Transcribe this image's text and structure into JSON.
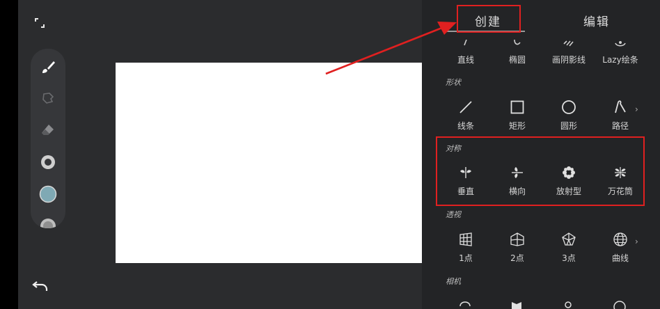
{
  "tabs": {
    "create": "创建",
    "edit": "编辑"
  },
  "sections": {
    "row0": {
      "items": [
        {
          "label": "直线",
          "icon": "straight-line-icon"
        },
        {
          "label": "椭圆",
          "icon": "ellipse-icon"
        },
        {
          "label": "画阴影线",
          "icon": "hatch-icon"
        },
        {
          "label": "Lazy绘条",
          "icon": "lazy-stroke-icon"
        }
      ]
    },
    "shape": {
      "title": "形状",
      "items": [
        {
          "label": "线条",
          "icon": "line-icon"
        },
        {
          "label": "矩形",
          "icon": "rectangle-icon"
        },
        {
          "label": "圆形",
          "icon": "circle-icon"
        },
        {
          "label": "路径",
          "icon": "path-icon"
        }
      ]
    },
    "symmetry": {
      "title": "对称",
      "items": [
        {
          "label": "垂直",
          "icon": "vertical-symmetry-icon"
        },
        {
          "label": "横向",
          "icon": "horizontal-symmetry-icon"
        },
        {
          "label": "放射型",
          "icon": "radial-symmetry-icon"
        },
        {
          "label": "万花筒",
          "icon": "kaleidoscope-icon"
        }
      ]
    },
    "perspective": {
      "title": "透视",
      "items": [
        {
          "label": "1点",
          "icon": "one-point-perspective-icon"
        },
        {
          "label": "2点",
          "icon": "two-point-perspective-icon"
        },
        {
          "label": "3点",
          "icon": "three-point-perspective-icon"
        },
        {
          "label": "曲线",
          "icon": "curvilinear-perspective-icon"
        }
      ]
    },
    "camera": {
      "title": "相机"
    }
  },
  "more_glyph": "›",
  "colors": {
    "accent_red": "#e02020",
    "brush_color": "#7fa9b4"
  }
}
